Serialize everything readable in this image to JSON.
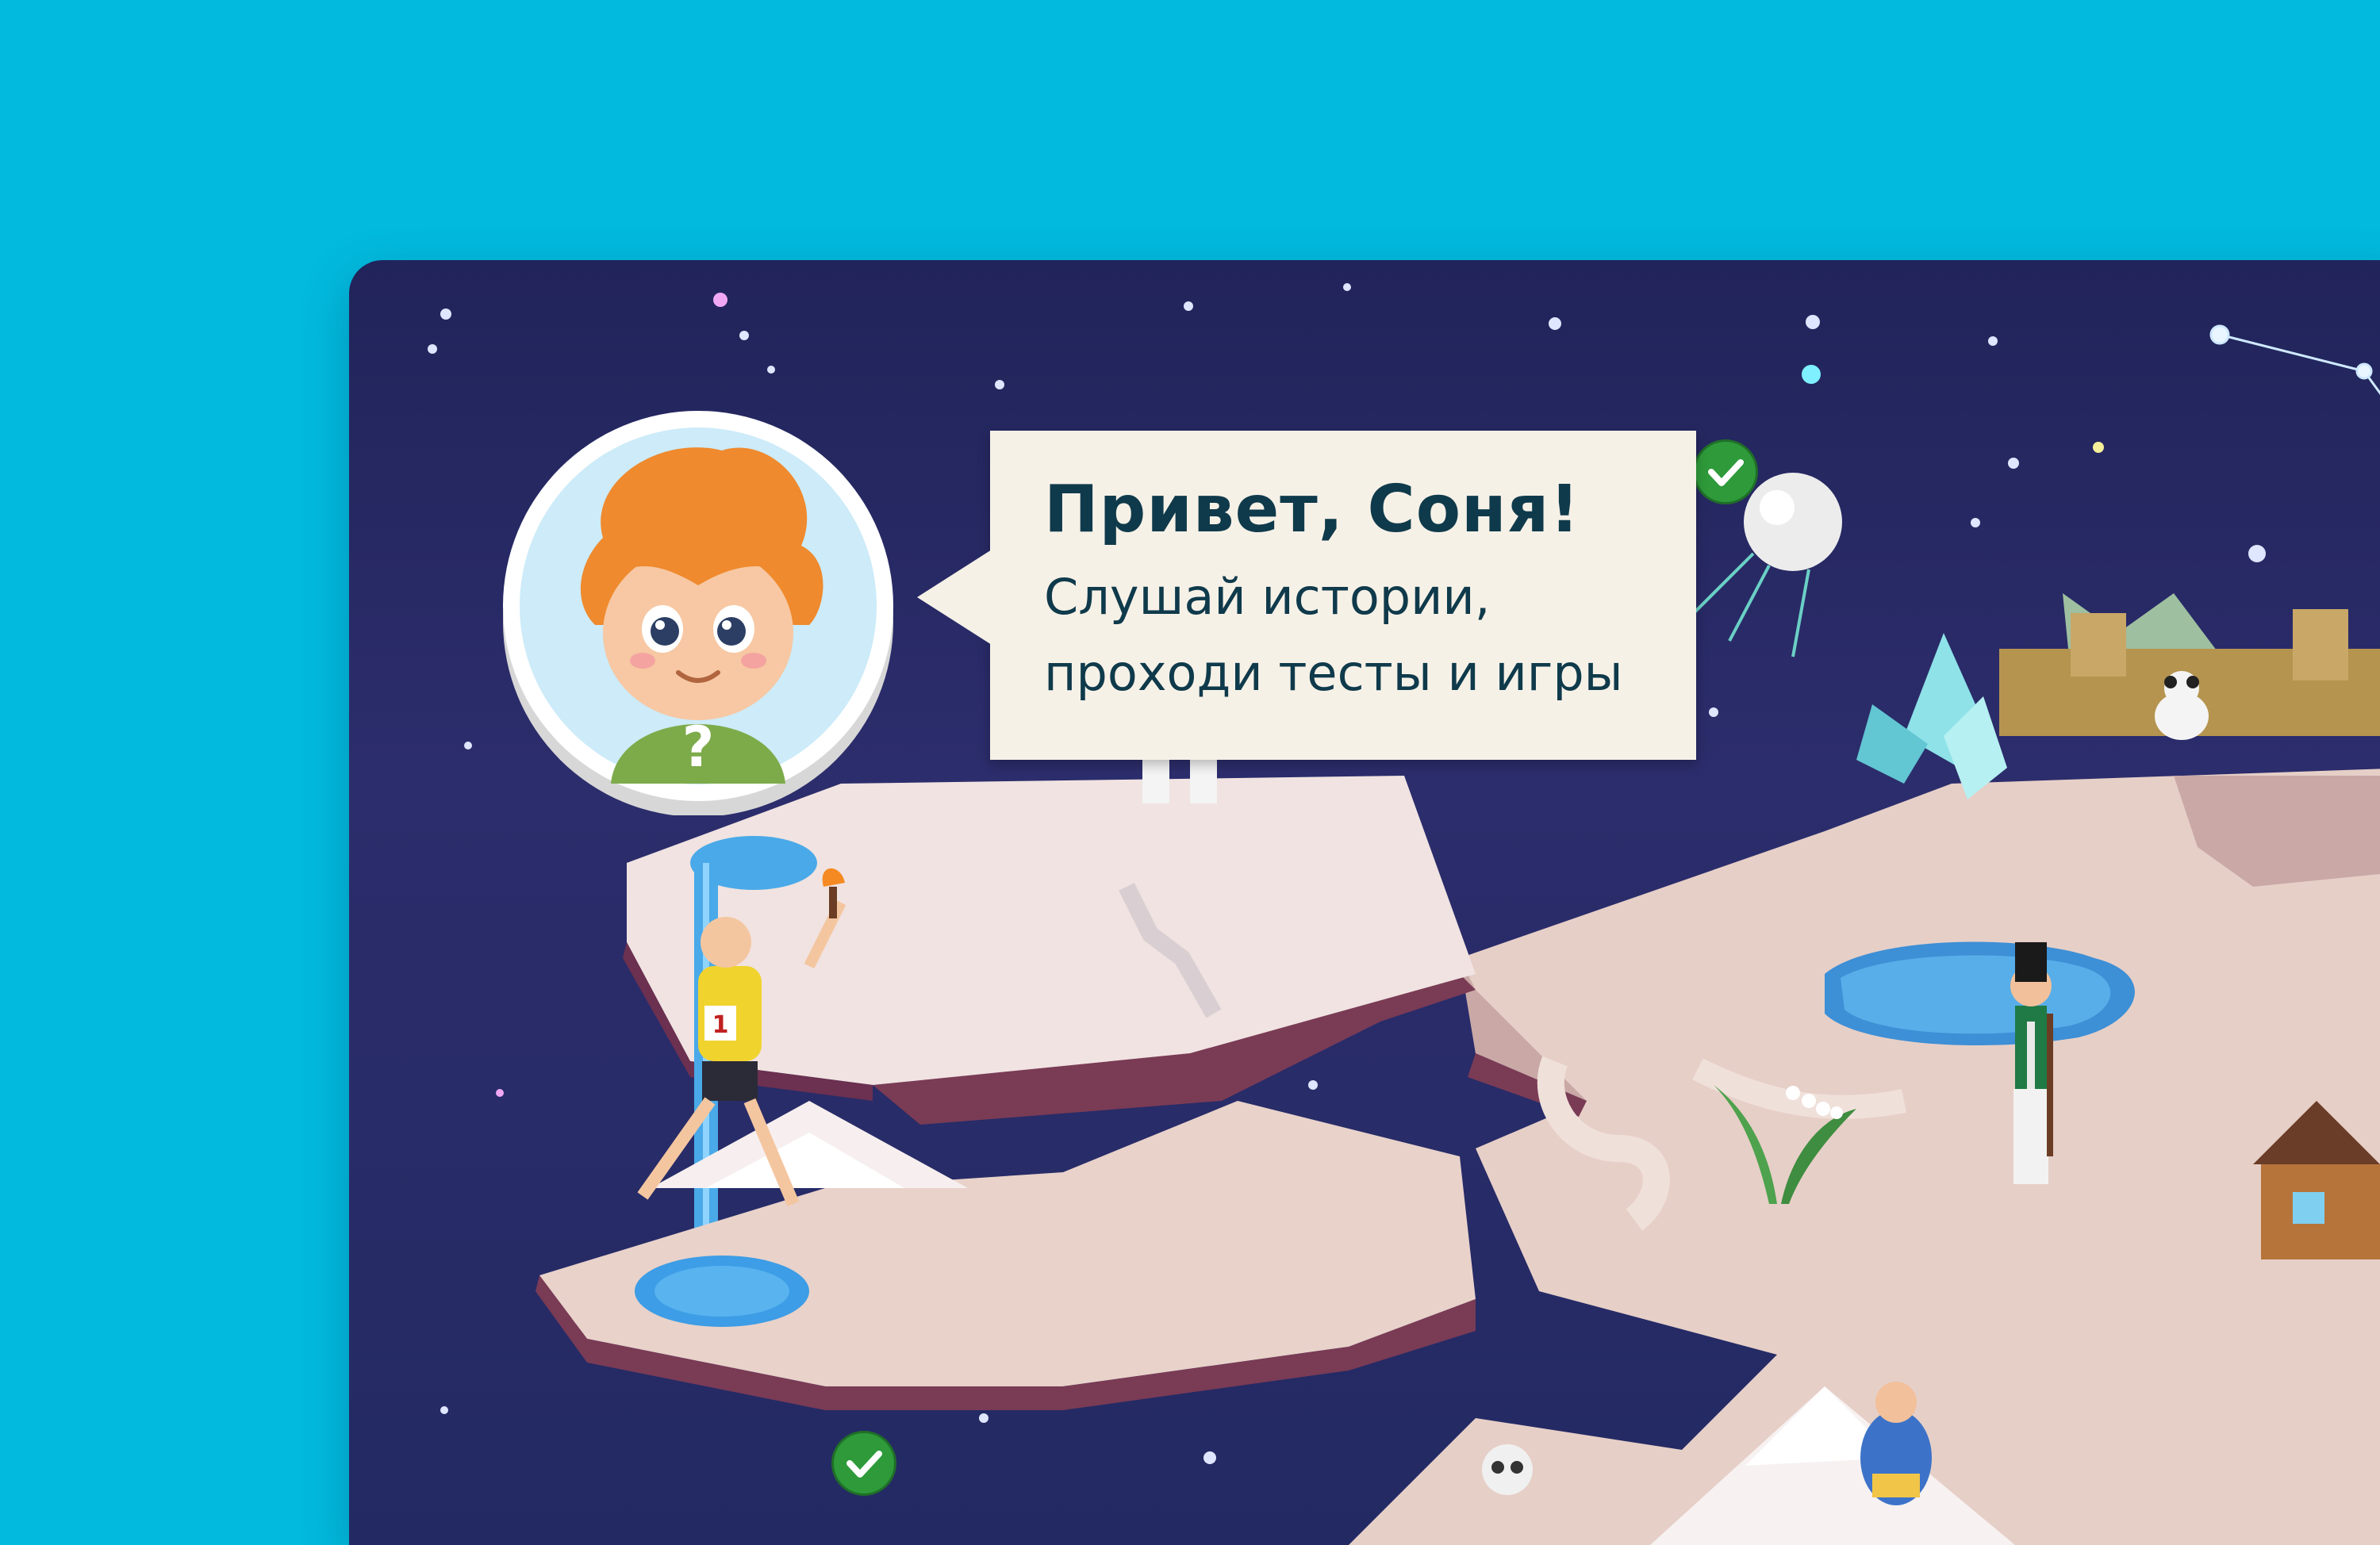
{
  "greeting": {
    "title": "Привет, Соня!",
    "line1": "Слушай истории,",
    "line2": "проходи тесты и игры"
  },
  "icons": {
    "avatar": "kid-guide-icon",
    "completed": "checkmark-icon",
    "athlete_bib": "1",
    "avatar_badge": "?"
  },
  "colors": {
    "page_background": "#02bade",
    "sky": "#21245a",
    "speech_bubble": "#f6f1e7",
    "text": "#0f3a4b",
    "check": "#2e9a3a"
  }
}
